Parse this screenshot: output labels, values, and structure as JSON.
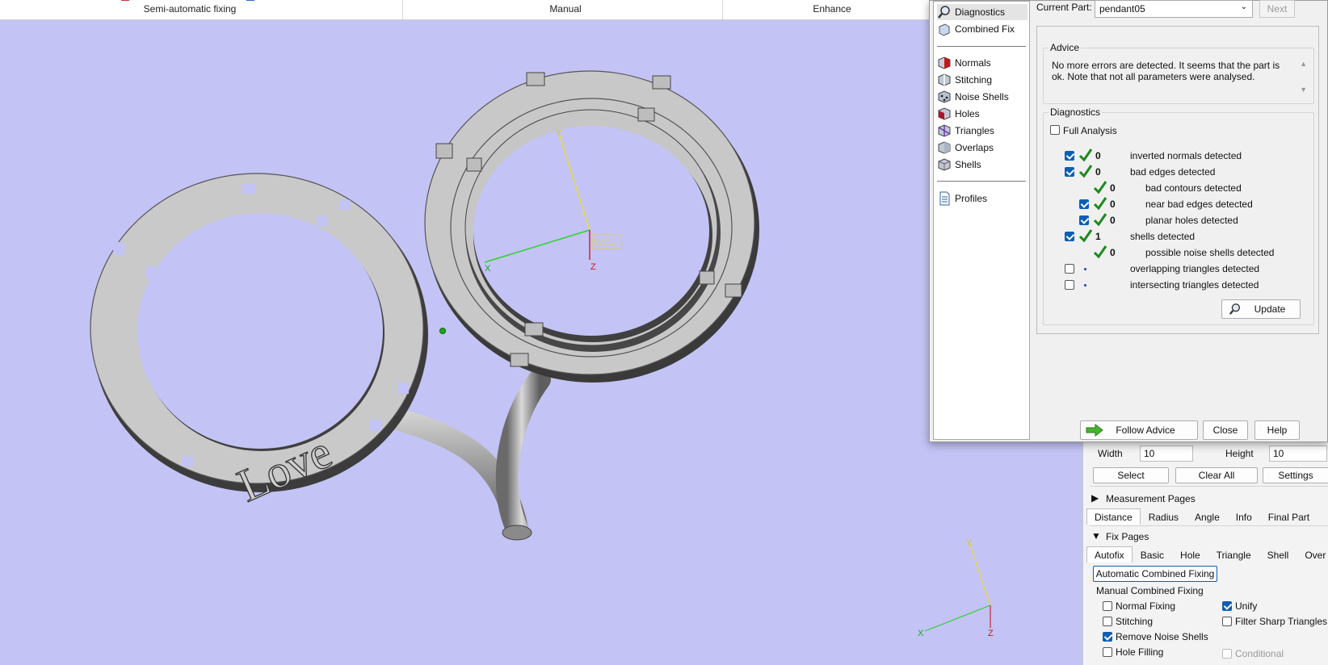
{
  "ribbon": {
    "groups": [
      "Semi-automatic fixing",
      "Manual",
      "Enhance"
    ]
  },
  "viewport": {
    "wcs_label": "WCS",
    "axes": {
      "x": "X",
      "y": "Y",
      "z": "Z"
    },
    "model_text": "Love",
    "background": "#c3c3f5"
  },
  "dialog": {
    "nav": [
      {
        "label": "Diagnostics",
        "icon": "magnifier-icon"
      },
      {
        "label": "Combined Fix",
        "icon": "combined-fix-icon"
      },
      {
        "label": "Normals",
        "icon": "normals-icon"
      },
      {
        "label": "Stitching",
        "icon": "stitching-icon"
      },
      {
        "label": "Noise Shells",
        "icon": "noise-shells-icon"
      },
      {
        "label": "Holes",
        "icon": "holes-icon"
      },
      {
        "label": "Triangles",
        "icon": "triangles-icon"
      },
      {
        "label": "Overlaps",
        "icon": "overlaps-icon"
      },
      {
        "label": "Shells",
        "icon": "shells-icon"
      },
      {
        "label": "Profiles",
        "icon": "profiles-icon"
      }
    ],
    "current_part_label": "Current Part:",
    "current_part_value": "pendant05",
    "next_label": "Next",
    "advice_title": "Advice",
    "advice_text": "No more errors are detected. It seems that the part is ok. Note that not all parameters were analysed.",
    "diagnostics_title": "Diagnostics",
    "full_analysis_label": "Full Analysis",
    "rows": [
      {
        "count": "0",
        "label": "inverted normals detected",
        "checked": true,
        "status": "ok"
      },
      {
        "count": "0",
        "label": "bad edges detected",
        "checked": true,
        "status": "ok"
      },
      {
        "count": "0",
        "label": "bad contours detected",
        "checked": null,
        "status": "ok"
      },
      {
        "count": "0",
        "label": "near bad edges detected",
        "checked": true,
        "status": "ok"
      },
      {
        "count": "0",
        "label": "planar holes detected",
        "checked": true,
        "status": "ok"
      },
      {
        "count": "1",
        "label": "shells detected",
        "checked": true,
        "status": "ok"
      },
      {
        "count": "0",
        "label": "possible noise shells detected",
        "checked": null,
        "status": "ok"
      },
      {
        "count": "",
        "label": "overlapping triangles detected",
        "checked": false,
        "status": "pending"
      },
      {
        "count": "",
        "label": "intersecting triangles detected",
        "checked": false,
        "status": "pending"
      }
    ],
    "update_label": "Update",
    "follow_advice_label": "Follow Advice",
    "close_label": "Close",
    "help_label": "Help",
    "tick_color": "#1d8a1d"
  },
  "right_panel": {
    "width_label": "Width",
    "width_value": "10",
    "height_label": "Height",
    "height_value": "10",
    "select_label": "Select",
    "clear_all_label": "Clear All",
    "settings_label": "Settings",
    "measurement_pages_label": "Measurement Pages",
    "measurement_tabs": [
      "Distance",
      "Radius",
      "Angle",
      "Info",
      "Final Part"
    ],
    "fix_pages_label": "Fix Pages",
    "fix_tabs": [
      "Autofix",
      "Basic",
      "Hole",
      "Triangle",
      "Shell",
      "Over"
    ],
    "auto_combined_label": "Automatic Combined Fixing",
    "manual_combined_label": "Manual Combined Fixing",
    "options": {
      "normal_fixing": "Normal Fixing",
      "unify": "Unify",
      "stitching": "Stitching",
      "filter_sharp": "Filter Sharp Triangles",
      "remove_noise": "Remove Noise Shells",
      "hole_filling": "Hole Filling",
      "conditional": "Conditional"
    }
  }
}
